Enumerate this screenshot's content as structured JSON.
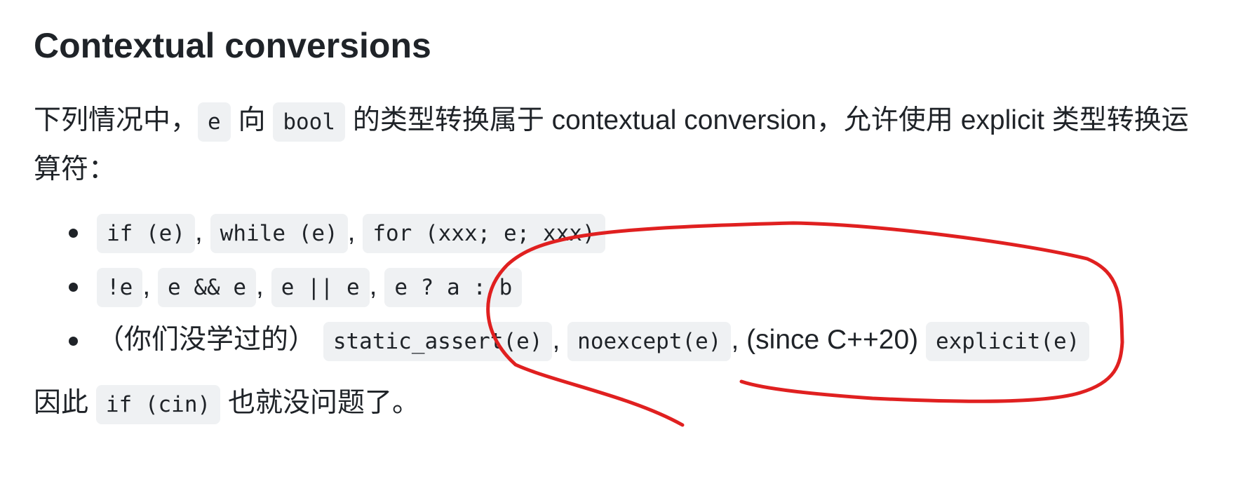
{
  "heading": "Contextual conversions",
  "intro": {
    "t1": "下列情况中，",
    "c1": "e",
    "t2": " 向 ",
    "c2": "bool",
    "t3": " 的类型转换属于 contextual conversion，允许使用 explicit 类型转换运算符："
  },
  "bullets": [
    {
      "codes": [
        "if (e)",
        "while (e)",
        "for (xxx; e; xxx)"
      ]
    },
    {
      "codes": [
        "!e",
        "e && e",
        "e || e",
        "e ? a : b"
      ]
    },
    {
      "prefix": "（你们没学过的）",
      "codes": [
        "static_assert(e)",
        "noexcept(e)"
      ],
      "mid": "(since C++20)",
      "last": "explicit(e)"
    }
  ],
  "separator": ",",
  "conclusion": {
    "t1": "因此 ",
    "code": "if (cin)",
    "t2": " 也就没问题了。"
  },
  "annotation": {
    "color": "#e02020"
  }
}
